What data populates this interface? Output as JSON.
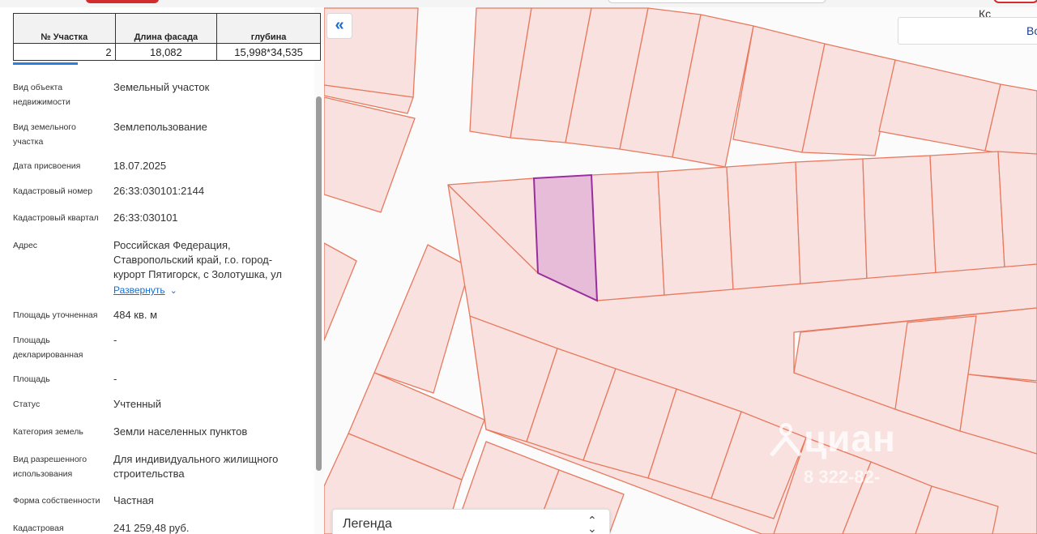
{
  "table": {
    "headers": [
      "№ Участка",
      "Длина фасада",
      "глубина"
    ],
    "row": [
      "2",
      "18,082",
      "15,998*34,535"
    ]
  },
  "info": [
    {
      "label": "Вид объекта недвижимости",
      "value": "Земельный участок"
    },
    {
      "label": "Вид земельного участка",
      "value": "Землепользование"
    },
    {
      "label": "Дата присвоения",
      "value": "18.07.2025"
    },
    {
      "label": "Кадастровый номер",
      "value": "26:33:030101:2144"
    },
    {
      "label": "Кадастровый квартал",
      "value": "26:33:030101"
    },
    {
      "label": "Адрес",
      "value": "Российская Федерация, Ставропольский край, г.о. город-курорт Пятигорск, с Золотушка, ул"
    },
    {
      "label": "Площадь уточненная",
      "value": "484 кв. м"
    },
    {
      "label": "Площадь декларированная",
      "value": "-"
    },
    {
      "label": "Площадь",
      "value": "-"
    },
    {
      "label": "Статус",
      "value": "Учтенный"
    },
    {
      "label": "Категория земель",
      "value": "Земли населенных пунктов"
    },
    {
      "label": "Вид разрешенного использования",
      "value": "Для индивидуального жилищного строительства"
    },
    {
      "label": "Форма собственности",
      "value": "Частная"
    },
    {
      "label": "Кадастровая",
      "value": "241 259,48 руб."
    }
  ],
  "address_expand": "Развернуть",
  "map": {
    "collapse_icon": "«",
    "search_text": "Во",
    "legend_label": "Легенда",
    "legend_icon": "chevron-up-down-icon",
    "watermark_text": "циан",
    "watermark_phone": "8 322-82-",
    "street_label": "Кс"
  },
  "colors": {
    "parcel_fill": "#f8e1de",
    "parcel_stroke": "#e8795f",
    "selected_fill": "#e6bcd8",
    "selected_stroke": "#9b2d9f",
    "accent": "#1a6dcc"
  }
}
